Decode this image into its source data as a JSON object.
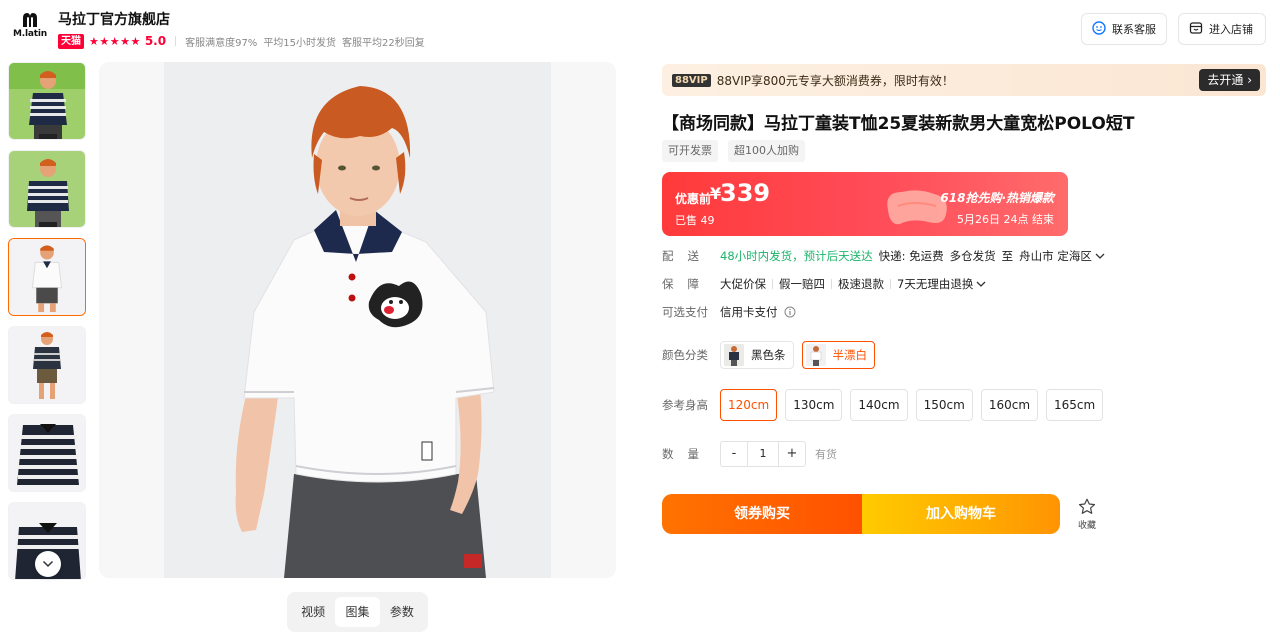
{
  "header": {
    "logo_text": "M.latin",
    "shop_name": "马拉丁官方旗舰店",
    "tmall_badge": "天猫",
    "stars": "★★★★★",
    "score": "5.0",
    "meta": [
      "客服满意度97%",
      "平均15小时发货",
      "客服平均22秒回复"
    ],
    "customer_service": "联系客服",
    "enter_store": "进入店铺"
  },
  "gallery": {
    "thumbnail_count": 6,
    "active_thumbnail": 3,
    "tabs": [
      "视频",
      "图集",
      "参数"
    ],
    "active_tab": "图集"
  },
  "vip": {
    "tag": "88VIP",
    "text": "88VIP享800元专享大额消费券，限时有效！",
    "button": "去开通 ›"
  },
  "product": {
    "title": "【商场同款】马拉丁童装T恤25夏装新款男大童宽松POLO短T",
    "tags": [
      "可开发票",
      "超100人加购"
    ]
  },
  "price": {
    "label": "优惠前",
    "currency": "¥",
    "value": "339",
    "sold": "已售 49",
    "promo": "618抢先购·热销爆款",
    "promo_end": "5月26日 24点 结束"
  },
  "delivery": {
    "label": "配送",
    "time": "48小时内发货，预计后天送达",
    "shipping": "快递: 免运费",
    "warehouse": "多仓发货",
    "to": "至",
    "location": "舟山市 定海区"
  },
  "guarantee": {
    "label": "保障",
    "items": [
      "大促价保",
      "假一赔四",
      "极速退款",
      "7天无理由退换"
    ]
  },
  "payment": {
    "label": "可选支付",
    "method": "信用卡支付"
  },
  "colors": {
    "label": "颜色分类",
    "options": [
      "黑色条",
      "半漂白"
    ],
    "selected": "半漂白"
  },
  "sizes": {
    "label": "参考身高",
    "options": [
      "120cm",
      "130cm",
      "140cm",
      "150cm",
      "160cm",
      "165cm"
    ],
    "selected": "120cm"
  },
  "quantity": {
    "label": "数量",
    "minus": "-",
    "value": "1",
    "plus": "+",
    "stock": "有货"
  },
  "actions": {
    "buy": "领券购买",
    "cart": "加入购物车",
    "favorite": "收藏"
  },
  "colors_theme": {
    "accent": "#ff5000",
    "tmall_red": "#ff0036",
    "price_red": "#ff3a3a",
    "green": "#1bb469"
  }
}
